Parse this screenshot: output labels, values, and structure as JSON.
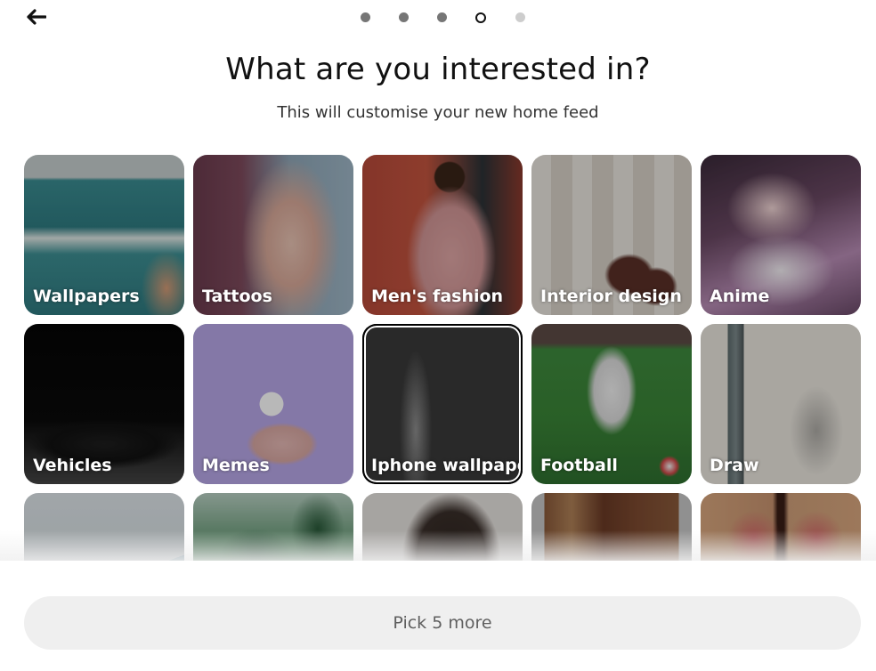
{
  "header": {
    "back_icon": "arrow-left-icon",
    "progress": {
      "total_steps": 5,
      "current_step": 4,
      "steps": [
        "done",
        "done",
        "done",
        "current",
        "todo"
      ]
    }
  },
  "title": "What are you interested in?",
  "subtitle": "This will customise your new home feed",
  "topics": [
    {
      "label": "Wallpapers",
      "image": "img-wallpapers",
      "focused": false
    },
    {
      "label": "Tattoos",
      "image": "img-tattoos",
      "focused": false
    },
    {
      "label": "Men's fashion",
      "image": "img-mens-fashion",
      "focused": false
    },
    {
      "label": "Interior design",
      "image": "img-interior",
      "focused": false
    },
    {
      "label": "Anime",
      "image": "img-anime",
      "focused": false
    },
    {
      "label": "Vehicles",
      "image": "img-vehicles",
      "focused": false
    },
    {
      "label": "Memes",
      "image": "img-memes",
      "focused": false
    },
    {
      "label": "Iphone wallpaper",
      "image": "img-iphone",
      "focused": true
    },
    {
      "label": "Football",
      "image": "img-football",
      "focused": false
    },
    {
      "label": "Draw",
      "image": "img-draw",
      "focused": false
    },
    {
      "label": "",
      "image": "img-house",
      "focused": false
    },
    {
      "label": "",
      "image": "img-garden",
      "focused": false
    },
    {
      "label": "",
      "image": "img-hair",
      "focused": false
    },
    {
      "label": "",
      "image": "img-room",
      "focused": false
    },
    {
      "label": "",
      "image": "img-floral-tattoo",
      "focused": false
    }
  ],
  "footer": {
    "cta_label": "Pick 5 more",
    "cta_enabled": false
  },
  "colors": {
    "dot_done": "#767676",
    "dot_current": "#111111",
    "dot_todo": "#cdcdcd",
    "cta_bg": "#efefef",
    "cta_text": "#5f5f5f"
  }
}
